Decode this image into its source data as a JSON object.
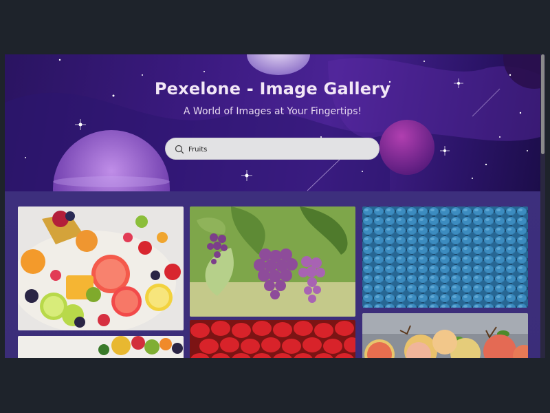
{
  "hero": {
    "title": "Pexelone - Image Gallery",
    "subtitle": "A World of Images at Your Fingertips!"
  },
  "search": {
    "value": "Fruits",
    "icon": "search-icon"
  },
  "gallery": {
    "items": [
      {
        "subject": "fruit platter"
      },
      {
        "subject": "purple grapes"
      },
      {
        "subject": "blueberries"
      },
      {
        "subject": "fruit platter"
      },
      {
        "subject": "strawberries"
      },
      {
        "subject": "apples"
      }
    ]
  },
  "colors": {
    "page_bg": "#1e232b",
    "hero_purple": "#3b1a80",
    "gallery_bg": "#3b2d79",
    "title_text": "#f2e7f6"
  }
}
